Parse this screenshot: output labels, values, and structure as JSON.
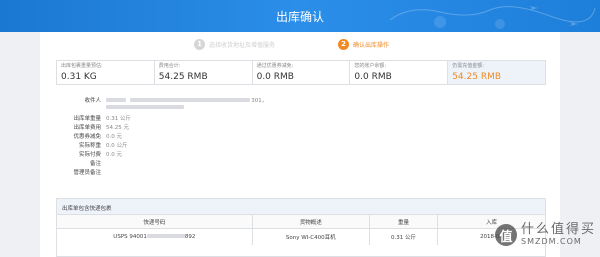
{
  "header": {
    "title": "出库确认"
  },
  "steps": [
    {
      "num": "1",
      "label": "选择收货地址及增值服务"
    },
    {
      "num": "2",
      "label": "确认出库操作"
    }
  ],
  "summary": [
    {
      "label": "出库包裹重量预估:",
      "value": "0.31 KG"
    },
    {
      "label": "费用合计:",
      "value": "54.25 RMB"
    },
    {
      "label": "通过优惠券减免:",
      "value": "0.0 RMB"
    },
    {
      "label": "您的账户余额:",
      "value": "0.0 RMB"
    },
    {
      "label": "仍需充值金额:",
      "value": "54.25 RMB"
    }
  ],
  "details": {
    "recipient_label": "收件人",
    "address_line1": "301，",
    "address_line2": "",
    "weight_label": "出库单重量",
    "weight_value": "0.31 公斤",
    "fee_label": "出库单费用",
    "fee_value": "54.25 元",
    "discount_label": "优惠券减免",
    "discount_value": "0.0 元",
    "actual_weight_label": "实际称重",
    "actual_weight_value": "0.0 公斤",
    "actual_pay_label": "实际付费",
    "actual_pay_value": "0.0 元",
    "remark_label": "备注",
    "admin_remark_label": "管理员备注"
  },
  "packages": {
    "title": "出库单包含快递包裹",
    "columns": [
      "快递号码",
      "货物概述",
      "重量",
      "入库"
    ],
    "rows": [
      {
        "tracking": "USPS 94001",
        "tracking_tail": "892",
        "desc": "Sony WI-C400耳机",
        "weight": "0.31 公斤",
        "date": "2018-07"
      }
    ]
  },
  "watermark": {
    "icon": "值",
    "line1": "什么值得买",
    "line2": "SMZDM.COM"
  }
}
